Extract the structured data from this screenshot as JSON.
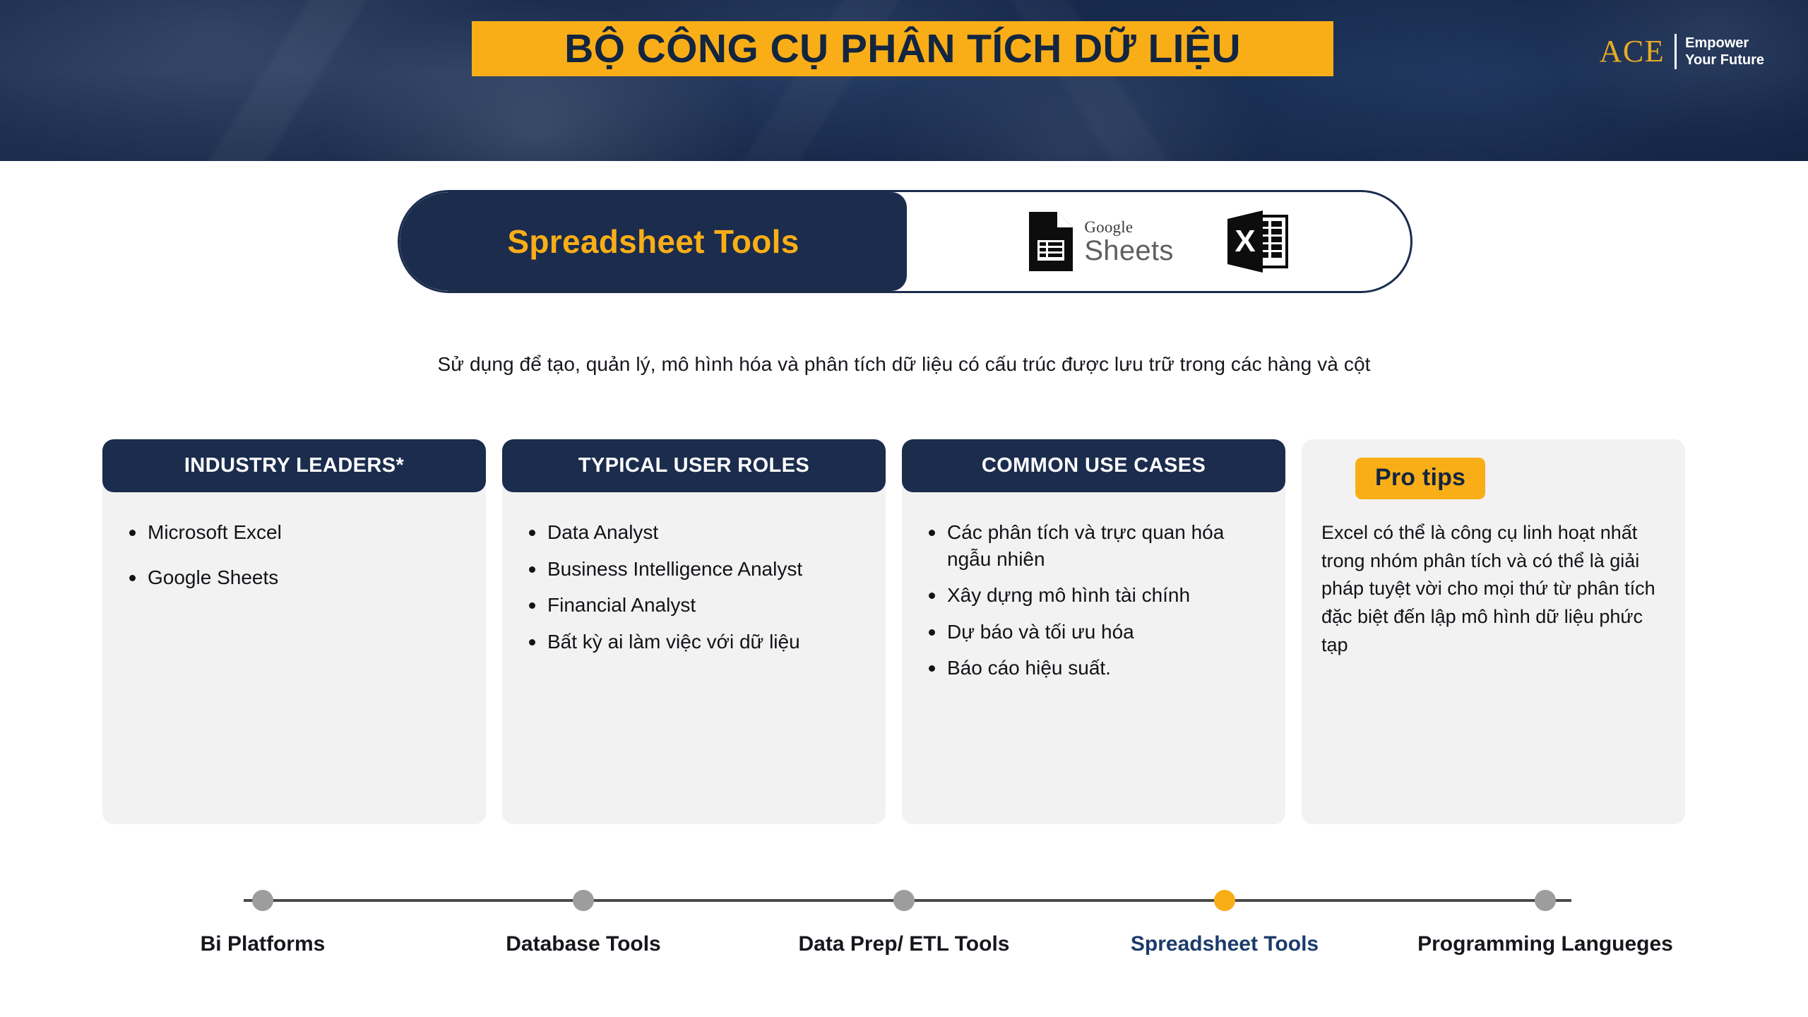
{
  "header": {
    "title": "BỘ CÔNG CỤ PHÂN TÍCH DỮ LIỆU",
    "logo_mark": "ACE",
    "logo_tagline_line1": "Empower",
    "logo_tagline_line2": "Your Future",
    "banner_color": "#f9ae18",
    "navy_color": "#1b2c4d"
  },
  "pill": {
    "label": "Spreadsheet Tools",
    "logos": [
      {
        "name": "google-sheets",
        "line1": "Google",
        "line2": "Sheets"
      },
      {
        "name": "microsoft-excel",
        "glyph": "X"
      }
    ]
  },
  "subtitle": "Sử dụng để tạo, quản lý, mô hình hóa và phân tích dữ liệu có cấu trúc được lưu trữ trong các hàng và cột",
  "cards": [
    {
      "heading": "INDUSTRY LEADERS*",
      "items": [
        "Microsoft Excel",
        "Google Sheets"
      ]
    },
    {
      "heading": "TYPICAL USER ROLES",
      "items": [
        "Data Analyst",
        "Business Intelligence Analyst",
        "Financial Analyst",
        "Bất kỳ ai làm việc với dữ liệu"
      ]
    },
    {
      "heading": "COMMON USE CASES",
      "items": [
        "Các phân tích và trực quan hóa ngẫu nhiên",
        "Xây dựng mô hình tài chính",
        "Dự báo và tối ưu hóa",
        "Báo cáo hiệu suất."
      ]
    }
  ],
  "pro_tips": {
    "badge": "Pro tips",
    "text": "Excel có thể là công cụ linh hoạt nhất trong nhóm phân tích và có thể là giải pháp tuyệt vời cho mọi thứ từ phân tích đặc biệt đến lập mô hình dữ liệu phức tạp",
    "badge_color": "#f9ae18"
  },
  "timeline": {
    "steps": [
      {
        "label": "Bi Platforms",
        "active": false
      },
      {
        "label": "Database Tools",
        "active": false
      },
      {
        "label": "Data Prep/ ETL Tools",
        "active": false
      },
      {
        "label": "Spreadsheet Tools",
        "active": true
      },
      {
        "label": "Programming Langueges",
        "active": false
      }
    ],
    "active_dot_color": "#f9ae18",
    "inactive_dot_color": "#9d9d9d",
    "active_label_color": "#1b3a6b"
  }
}
